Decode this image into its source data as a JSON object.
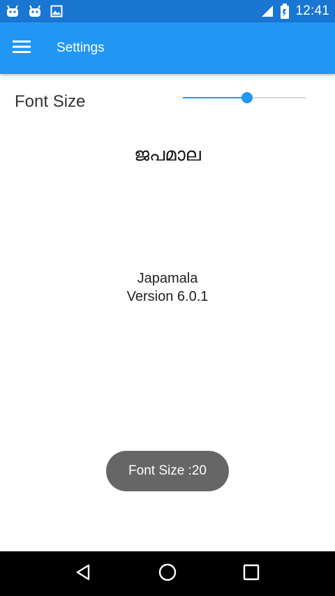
{
  "status_bar": {
    "time": "12:41",
    "icons": [
      "android-icon",
      "android-icon",
      "image-icon",
      "signal-icon",
      "battery-icon"
    ]
  },
  "app_bar": {
    "title": "Settings",
    "color": "#2196f3"
  },
  "settings": {
    "font_size_label": "Font Size",
    "slider_level": 0.52
  },
  "content": {
    "malayalam_title": "ജപമാല",
    "app_name": "Japamala",
    "version": "Version 6.0.1"
  },
  "toast": {
    "text": "Font Size :20"
  },
  "nav_bar": {
    "buttons": [
      "back-icon",
      "home-icon",
      "recents-icon"
    ]
  }
}
